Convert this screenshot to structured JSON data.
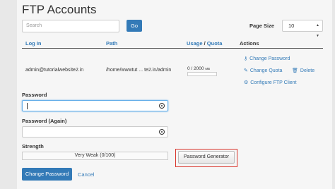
{
  "page": {
    "title": "FTP Accounts"
  },
  "search": {
    "placeholder": "Search",
    "go_label": "Go"
  },
  "pagination": {
    "label": "Page Size",
    "selected": "10"
  },
  "table": {
    "headers": {
      "login": "Log In",
      "path": "Path",
      "usage": "Usage",
      "separator": "/",
      "quota": "Quota",
      "actions": "Actions"
    },
    "row": {
      "login": "admin@tutorialwebsite2.in",
      "path": "/home/wwwtut ... te2.in/admin",
      "usage_value": "0 / 2000",
      "usage_unit": "MB",
      "usage_fraction": 0,
      "actions": {
        "change_password": "Change Password",
        "change_quota": "Change Quota",
        "delete": "Delete",
        "configure": "Configure FTP Client"
      }
    }
  },
  "form": {
    "password_label": "Password",
    "password_value": "",
    "password_again_label": "Password (Again)",
    "password_again_value": "",
    "strength_label": "Strength",
    "strength_text": "Very Weak (0/100)",
    "generator_label": "Password Generator",
    "submit_label": "Change Password",
    "cancel_label": "Cancel"
  },
  "colors": {
    "accent": "#337ab7",
    "highlight": "#d9342b"
  }
}
